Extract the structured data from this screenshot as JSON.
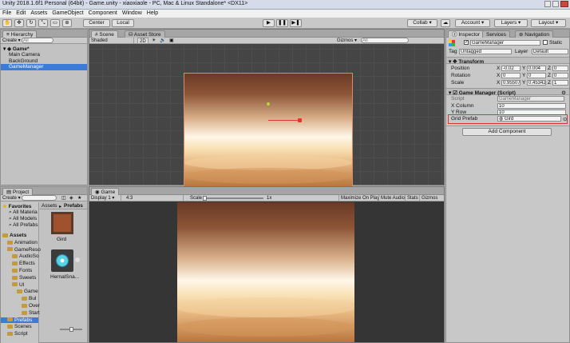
{
  "title": "Unity 2018.1.6f1 Personal (64bit) - Game.unity - xiaoxiaole - PC, Mac & Linux Standalone* <DX11>",
  "menu": [
    "File",
    "Edit",
    "Assets",
    "GameObject",
    "Component",
    "Window",
    "Help"
  ],
  "toolbar": {
    "pivot_center": "Center",
    "pivot_local": "Local",
    "collab": "Collab",
    "account": "Account",
    "layers": "Layers",
    "layout": "Layout"
  },
  "hierarchy": {
    "tab": "Hierarchy",
    "create": "Create",
    "search_placeholder": "All",
    "scene": "Game*",
    "items": [
      "Main Camera",
      "BackGround",
      "GameManager"
    ]
  },
  "scene_view": {
    "tabs": [
      "Scene",
      "Asset Store"
    ],
    "shading": "Shaded",
    "mode": "2D",
    "gizmos": "Gizmos",
    "search_placeholder": "All"
  },
  "game_view": {
    "tab": "Game",
    "display": "Display 1",
    "aspect": "4:3",
    "scale_label": "Scale",
    "scale_value": "1x",
    "buttons": [
      "Maximize On Play",
      "Mute Audio",
      "Stats",
      "Gizmos"
    ]
  },
  "project": {
    "tab": "Project",
    "create": "Create",
    "favorites": "Favorites",
    "favorite_items": [
      "All Materia",
      "All Models",
      "All Prefabs"
    ],
    "tree": [
      {
        "label": "Assets",
        "indent": 0,
        "bold": true
      },
      {
        "label": "Animation",
        "indent": 1
      },
      {
        "label": "GameReso",
        "indent": 1
      },
      {
        "label": "AudioSo",
        "indent": 2
      },
      {
        "label": "Effects",
        "indent": 2
      },
      {
        "label": "Fonts",
        "indent": 2
      },
      {
        "label": "Sweets",
        "indent": 2
      },
      {
        "label": "UI",
        "indent": 2
      },
      {
        "label": "Game",
        "indent": 3
      },
      {
        "label": "Bul",
        "indent": 4
      },
      {
        "label": "Over",
        "indent": 4
      },
      {
        "label": "Start",
        "indent": 4
      },
      {
        "label": "Prefabs",
        "indent": 1,
        "selected": true
      },
      {
        "label": "Scenes",
        "indent": 1
      },
      {
        "label": "Script",
        "indent": 1
      }
    ],
    "breadcrumb": [
      "Assets",
      "Prefabs"
    ],
    "assets": [
      {
        "name": "Gird",
        "icon": "prefab-thumbnail"
      },
      {
        "name": "HernalSna...",
        "icon": "sweet-thumbnail"
      }
    ]
  },
  "inspector": {
    "tabs": [
      "Inspector",
      "Services",
      "Navigation"
    ],
    "object_name": "GameManager",
    "static_label": "Static",
    "tag_label": "Tag",
    "tag_value": "Untagged",
    "layer_label": "Layer",
    "layer_value": "Default",
    "transform": {
      "title": "Transform",
      "rows": [
        {
          "label": "Position",
          "x": "-0.02",
          "y": "0.004",
          "z": "0"
        },
        {
          "label": "Rotation",
          "x": "0",
          "y": "0",
          "z": "0"
        },
        {
          "label": "Scale",
          "x": "0.95507",
          "y": "0.45342",
          "z": "1"
        }
      ]
    },
    "component": {
      "title": "Game Manager (Script)",
      "script_label": "Script",
      "script_value": "GameManager",
      "fields": [
        {
          "label": "X Column",
          "value": "10"
        },
        {
          "label": "Y Row",
          "value": "10"
        }
      ],
      "prefab_label": "Grid Prefab",
      "prefab_value": "Gird"
    },
    "add_component": "Add Component"
  },
  "colors": {
    "selection": "#3d7bd9",
    "highlight_outline": "#e03030",
    "sky_top": "#6a3a26",
    "sky_glow": "#fff7e8"
  }
}
